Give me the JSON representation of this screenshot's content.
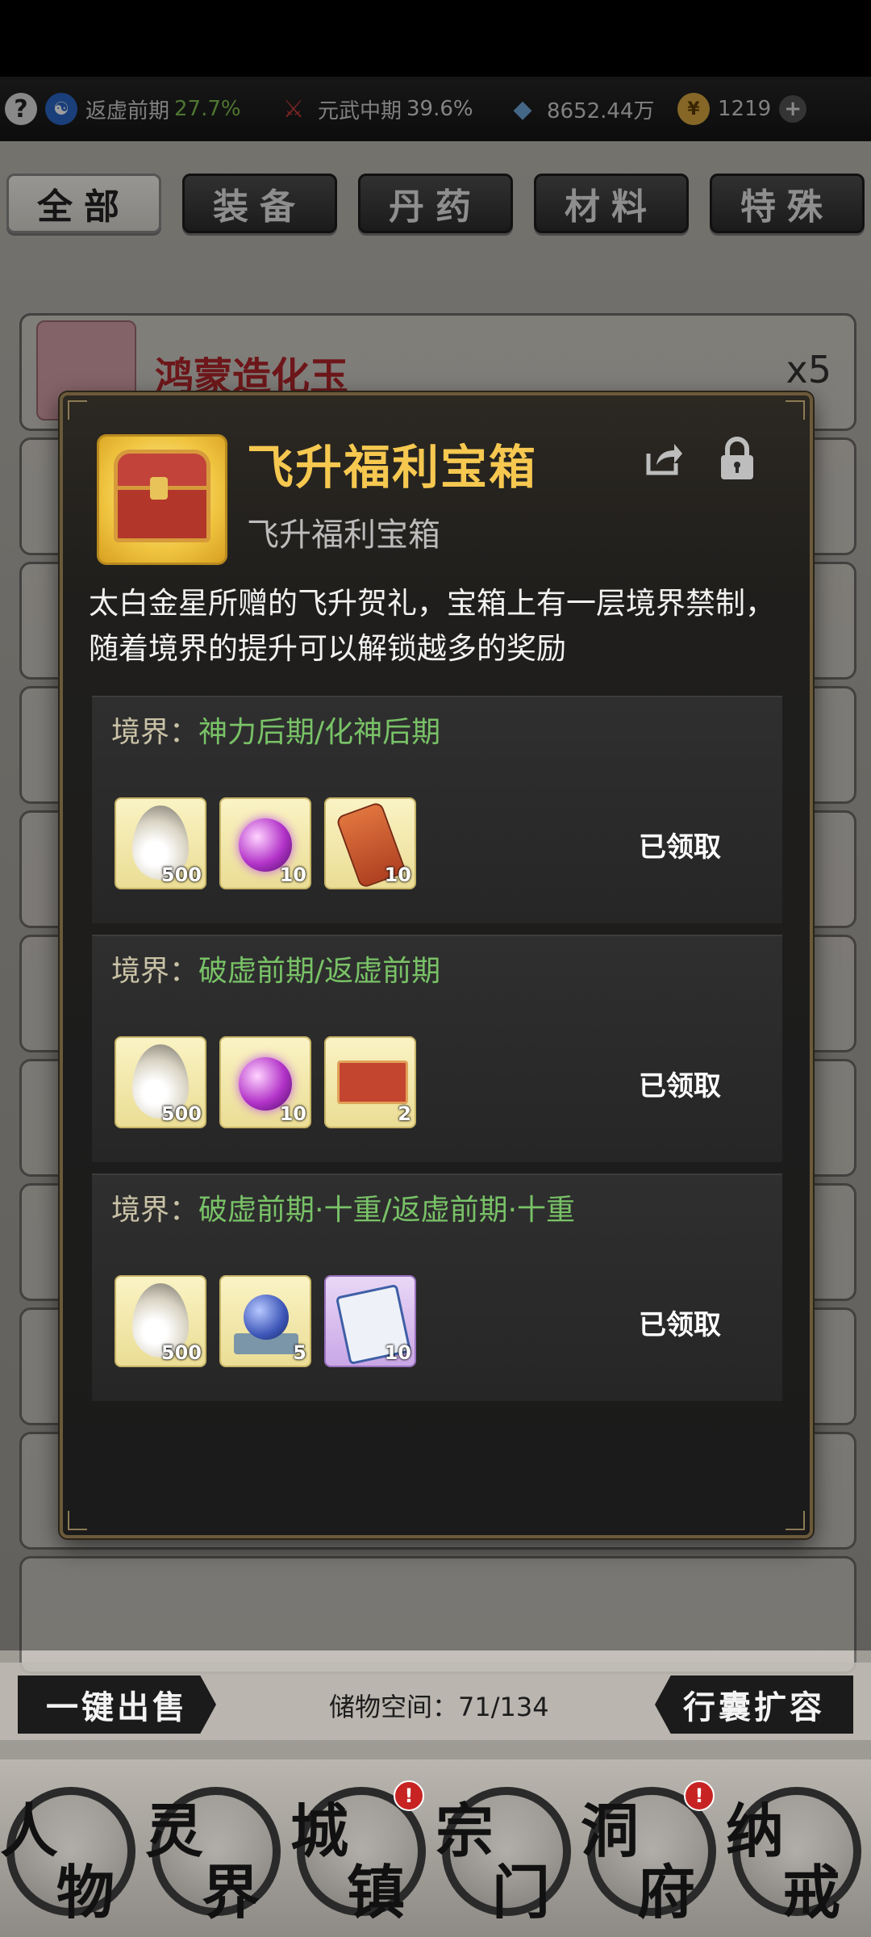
{
  "status": {
    "realm1": {
      "label": "返虚前期",
      "pct": "27.7%"
    },
    "realm2": {
      "label": "元武中期",
      "pct": "39.6%"
    },
    "crystals": "8652.44万",
    "coins": "1219"
  },
  "tabs": [
    "全部",
    "装备",
    "丹药",
    "材料",
    "特殊"
  ],
  "background_list": {
    "first_item": {
      "name": "鸿蒙造化玉",
      "qty": "x5"
    }
  },
  "modal": {
    "title": "飞升福利宝箱",
    "subtitle": "飞升福利宝箱",
    "description": "太白金星所赠的飞升贺礼，宝箱上有一层境界禁制，随着境界的提升可以解锁越多的奖励",
    "tiers": [
      {
        "prefix": "境界：",
        "realm": "神力后期/化神后期",
        "rewards": [
          "500",
          "10",
          "10"
        ],
        "status": "已领取"
      },
      {
        "prefix": "境界：",
        "realm": "破虚前期/返虚前期",
        "rewards": [
          "500",
          "10",
          "2"
        ],
        "status": "已领取"
      },
      {
        "prefix": "境界：",
        "realm": "破虚前期·十重/返虚前期·十重",
        "rewards": [
          "500",
          "5",
          "10"
        ],
        "status": "已领取"
      }
    ]
  },
  "bottom": {
    "sell": "一键出售",
    "storage": "储物空间：71/134",
    "expand": "行囊扩容"
  },
  "nav": [
    {
      "c1": "人",
      "c2": "物"
    },
    {
      "c1": "灵",
      "c2": "界"
    },
    {
      "c1": "城",
      "c2": "镇",
      "badge": "!"
    },
    {
      "c1": "宗",
      "c2": "门"
    },
    {
      "c1": "洞",
      "c2": "府",
      "badge": "!"
    },
    {
      "c1": "纳",
      "c2": "戒"
    }
  ]
}
